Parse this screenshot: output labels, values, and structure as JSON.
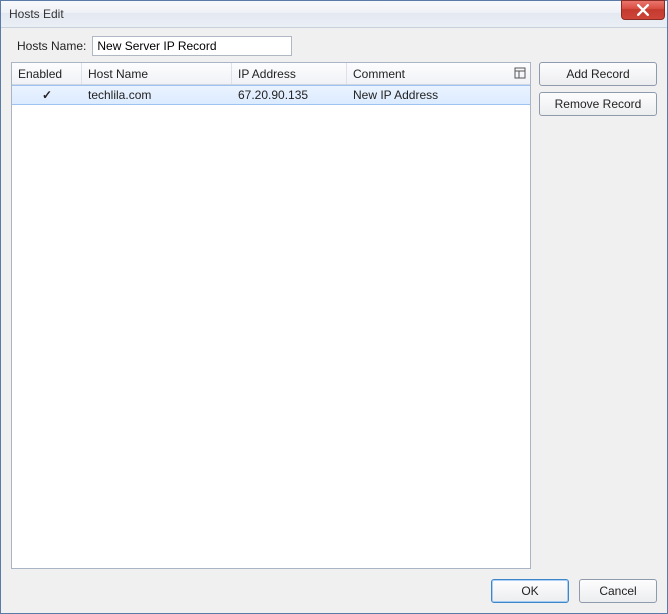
{
  "window": {
    "title": "Hosts Edit"
  },
  "form": {
    "hosts_name_label": "Hosts Name:",
    "hosts_name_value": "New Server IP Record"
  },
  "table": {
    "columns": {
      "enabled": "Enabled",
      "host": "Host Name",
      "ip": "IP Address",
      "comment": "Comment"
    },
    "rows": [
      {
        "enabled": true,
        "host": "techlila.com",
        "ip": "67.20.90.135",
        "comment": "New IP Address"
      }
    ]
  },
  "buttons": {
    "add_record": "Add Record",
    "remove_record": "Remove Record",
    "ok": "OK",
    "cancel": "Cancel"
  },
  "glyphs": {
    "check": "✓"
  }
}
